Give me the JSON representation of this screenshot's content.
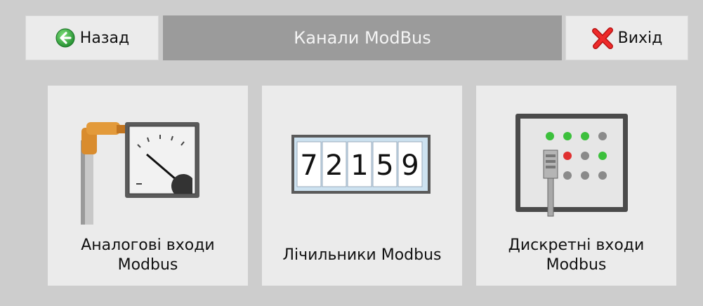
{
  "header": {
    "title": "Канали ModBus",
    "back_label": "Назад",
    "exit_label": "Вихід",
    "back_icon": "arrow-left-circle-icon",
    "exit_icon": "red-x-icon"
  },
  "tiles": [
    {
      "label": "Аналогові входи\nModbus",
      "icon": "analog-gauge-sensor-icon"
    },
    {
      "label": "Лічильники Modbus",
      "icon": "counter-display-icon",
      "counter_digits": [
        "7",
        "2",
        "1",
        "5",
        "9"
      ]
    },
    {
      "label": "Дискретні входи\nModbus",
      "icon": "discrete-input-panel-icon"
    }
  ],
  "colors": {
    "background": "#cdcdcd",
    "tile": "#ebebeb",
    "title_bar": "#9b9b9b",
    "back_icon": "#2eaa3c",
    "exit_icon": "#e02020",
    "led_green": "#3cc03c",
    "led_red": "#e03030",
    "led_gray": "#8a8a8a"
  }
}
